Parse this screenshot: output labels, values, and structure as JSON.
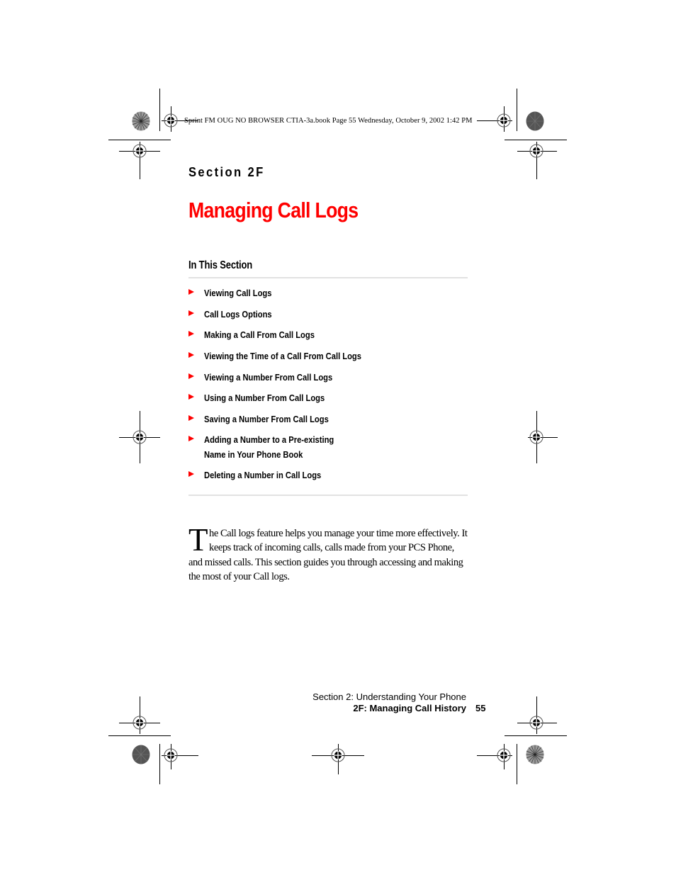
{
  "slug_line": "Sprint FM OUG NO BROWSER CTIA-3a.book  Page 55  Wednesday, October 9, 2002  1:42 PM",
  "section_label": "Section 2F",
  "title": "Managing Call Logs",
  "in_this_section": {
    "heading": "In This Section",
    "items": [
      {
        "label": "Viewing Call Logs"
      },
      {
        "label": "Call Logs Options"
      },
      {
        "label": "Making a Call From Call Logs"
      },
      {
        "label": "Viewing the Time of a Call From Call Logs"
      },
      {
        "label": "Viewing a Number From Call Logs"
      },
      {
        "label": "Using a Number From Call Logs"
      },
      {
        "label": "Saving a Number From Call Logs"
      },
      {
        "label": "Adding a Number to a Pre-existing",
        "label_line2": "Name in Your Phone Book"
      },
      {
        "label": "Deleting a Number in Call Logs"
      }
    ]
  },
  "body": {
    "dropcap": "T",
    "text": "he Call logs feature helps you manage your time more effectively. It keeps track of incoming calls, calls made from your PCS Phone, and missed calls. This section guides you through accessing and making the most of your Call logs."
  },
  "footer": {
    "section": "Section 2: Understanding Your Phone",
    "chapter": "2F: Managing Call History",
    "page_number": "55"
  },
  "colors": {
    "accent_red": "#ff0000",
    "rule_gray": "#e2e2e2",
    "text": "#000000"
  }
}
